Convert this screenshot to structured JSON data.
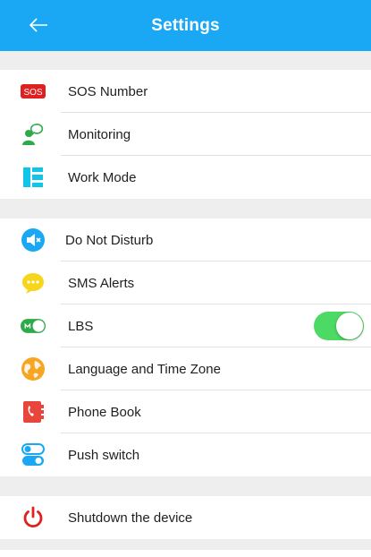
{
  "header": {
    "title": "Settings",
    "back_icon": "arrow-left-icon"
  },
  "colors": {
    "header_bg": "#1aa8f5",
    "toggle_on": "#4cd964",
    "divider": "#eeeeee"
  },
  "groups": [
    {
      "items": [
        {
          "label": "SOS Number",
          "icon": "sos-icon",
          "sos_text": "SOS"
        },
        {
          "label": "Monitoring",
          "icon": "monitoring-icon"
        },
        {
          "label": "Work Mode",
          "icon": "work-mode-icon"
        }
      ]
    },
    {
      "items": [
        {
          "label": "Do Not Disturb",
          "icon": "mute-speaker-icon"
        },
        {
          "label": "SMS Alerts",
          "icon": "chat-bubble-icon"
        },
        {
          "label": "LBS",
          "icon": "lbs-toggle-icon",
          "toggle_on": true
        },
        {
          "label": "Language and Time Zone",
          "icon": "globe-icon"
        },
        {
          "label": "Phone Book",
          "icon": "phone-book-icon"
        },
        {
          "label": "Push switch",
          "icon": "push-switch-icon"
        }
      ]
    },
    {
      "items": [
        {
          "label": "Shutdown the device",
          "icon": "power-icon"
        }
      ]
    }
  ]
}
